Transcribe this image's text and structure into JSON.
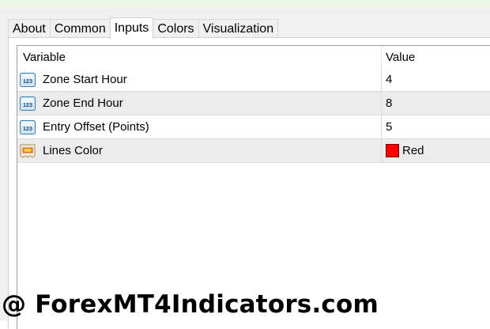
{
  "tabs": [
    {
      "label": "About",
      "active": false
    },
    {
      "label": "Common",
      "active": false
    },
    {
      "label": "Inputs",
      "active": true
    },
    {
      "label": "Colors",
      "active": false
    },
    {
      "label": "Visualization",
      "active": false
    }
  ],
  "table": {
    "headers": {
      "variable": "Variable",
      "value": "Value"
    },
    "rows": [
      {
        "variable": "Zone Start Hour",
        "value": "4",
        "icon": "numeric-123-icon"
      },
      {
        "variable": "Zone End Hour",
        "value": "8",
        "icon": "numeric-123-icon"
      },
      {
        "variable": "Entry Offset (Points)",
        "value": "5",
        "icon": "numeric-123-icon"
      },
      {
        "variable": "Lines Color",
        "value": "Red",
        "icon": "color-palette-icon",
        "swatch": "#ff0000"
      }
    ]
  },
  "watermark": "@ ForexMT4Indicators.com"
}
